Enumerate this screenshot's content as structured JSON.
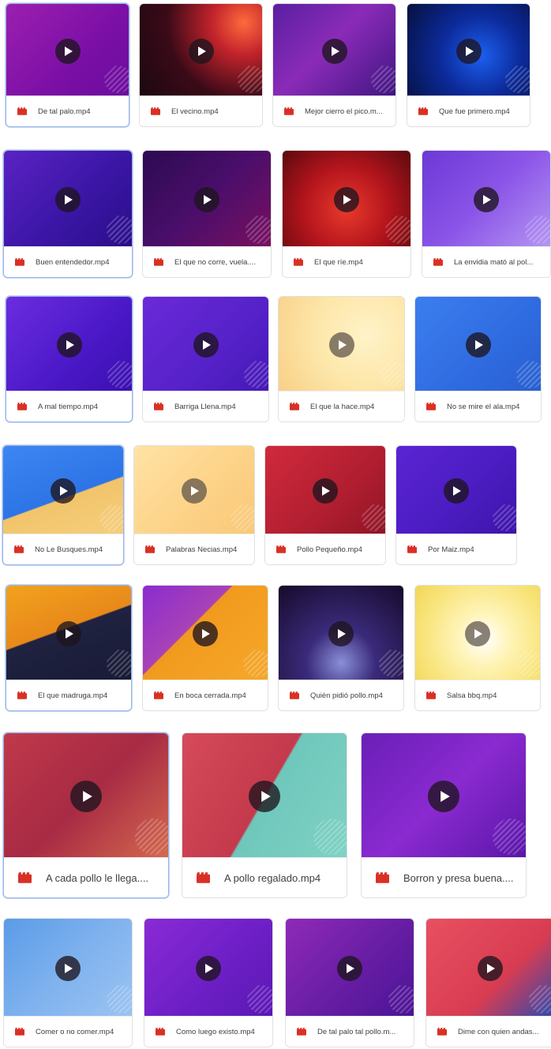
{
  "files": [
    {
      "name": "De tal palo.mp4",
      "bg": "linear-gradient(135deg,#9c1fb0 0%,#7b0fa6 60%,#6a0d9c 100%)",
      "selected": true
    },
    {
      "name": "El vecino.mp4",
      "bg": "radial-gradient(circle at 85% 20%,#ff6a3d 0%,#c2232b 25%,#3a0a18 60%,#1a0810 100%)"
    },
    {
      "name": "Mejor cierro el pico.m...",
      "bg": "linear-gradient(135deg,#5a1fa0 0%,#8a2bb8 45%,#3f1580 100%)"
    },
    {
      "name": "Que fue primero.mp4",
      "bg": "radial-gradient(circle at 60% 55%,#1c5ff0 0%,#0c2a9a 45%,#06103e 100%)"
    },
    {
      "name": "Buen entendedor.mp4",
      "bg": "linear-gradient(135deg,#5b22c4 0%,#3b16a6 55%,#2a0e88 100%)",
      "selected": true
    },
    {
      "name": "El que no corre, vuela....",
      "bg": "linear-gradient(135deg,#2c0a52 0%,#4a0e6a 50%,#7a1060 100%)"
    },
    {
      "name": "El que ríe.mp4",
      "bg": "radial-gradient(circle at 50% 60%,#e83a2c 0%,#b3141c 50%,#5a0a0e 100%)"
    },
    {
      "name": "La envidia mató al pol...",
      "bg": "linear-gradient(135deg,#6c38d6 0%,#8b55e8 50%,#b597f2 100%)"
    },
    {
      "name": "A mal tiempo.mp4",
      "bg": "linear-gradient(135deg,#6b2ce0 0%,#4a18c6 60%,#3a10b0 100%)",
      "selected": true
    },
    {
      "name": "Barriga Llena.mp4",
      "bg": "linear-gradient(135deg,#6a2ad8 0%,#5521c8 60%,#4518b6 100%)"
    },
    {
      "name": "El que la hace.mp4",
      "bg": "radial-gradient(circle at 70% 40%,#fff3c8 0%,#fde6a8 50%,#f8cf86 100%)"
    },
    {
      "name": "No se mire el ala.mp4",
      "bg": "linear-gradient(135deg,#3b7ef0 0%,#2f6be0 60%,#295fd0 100%)"
    },
    {
      "name": "No Le Busques.mp4",
      "bg": "linear-gradient(160deg,#3d86f2 0%,#2d74e6 55%,#f2c46a 56%,#f5cf7e 100%)",
      "selected": true
    },
    {
      "name": "Palabras Necias.mp4",
      "bg": "linear-gradient(135deg,#ffe3a6 0%,#fdd48a 50%,#f9c878 100%)"
    },
    {
      "name": "Pollo Pequeño.mp4",
      "bg": "linear-gradient(135deg,#d02a3c 0%,#b01e30 60%,#8e1526 100%)"
    },
    {
      "name": "Por Maiz.mp4",
      "bg": "linear-gradient(135deg,#5a24d4 0%,#4a1cc0 60%,#3c14a8 100%)"
    },
    {
      "name": "El que madruga.mp4",
      "bg": "linear-gradient(160deg,#f2a21e 0%,#e8891a 45%,#1f2240 46%,#181a36 100%)",
      "selected": true
    },
    {
      "name": "En boca cerrada.mp4",
      "bg": "linear-gradient(135deg,#8a2cd0 0%,#a842b6 40%,#f29a1e 41%,#f5a82a 100%)"
    },
    {
      "name": "Quién pidió pollo.mp4",
      "bg": "radial-gradient(circle at 50% 80%,#8a8fd8 0%,#3a2a7a 35%,#160a2a 100%)"
    },
    {
      "name": "Salsa bbq.mp4",
      "bg": "radial-gradient(circle at 55% 55%,#ffffff 0%,#fff4b8 30%,#f8e47a 70%,#f2d658 100%)"
    },
    {
      "name": "A cada pollo le llega....",
      "bg": "linear-gradient(135deg,#c0394a 0%,#a82a44 50%,#d46a4e 100%)",
      "selected": true
    },
    {
      "name": "A pollo regalado.mp4",
      "bg": "linear-gradient(120deg,#d64a5a 0%,#c43a4c 50%,#6fc7bb 51%,#7fd2c4 100%)"
    },
    {
      "name": "Borron y presa buena....",
      "bg": "linear-gradient(135deg,#6a1fb8 0%,#8a2ad0 50%,#5a16a8 100%)"
    },
    {
      "name": "Comer o no comer.mp4",
      "bg": "linear-gradient(135deg,#5a9be8 0%,#7fb2ee 50%,#9cc4f2 100%)"
    },
    {
      "name": "Como luego existo.mp4",
      "bg": "linear-gradient(135deg,#8a2ad6 0%,#7020c8 50%,#5a18b4 100%)"
    },
    {
      "name": "De tal palo tal pollo.m...",
      "bg": "linear-gradient(135deg,#8f2ab8 0%,#6a1ea6 50%,#4a1496 100%)"
    },
    {
      "name": "Dime con quien andas...",
      "bg": "linear-gradient(135deg,#e85060 0%,#d83c52 60%,#2a4ab0 100%)"
    }
  ],
  "colors": {
    "video_icon": "#d93025",
    "label_text": "#3c4043",
    "play_bg": "#1e141e"
  },
  "icon": "video-file-icon"
}
